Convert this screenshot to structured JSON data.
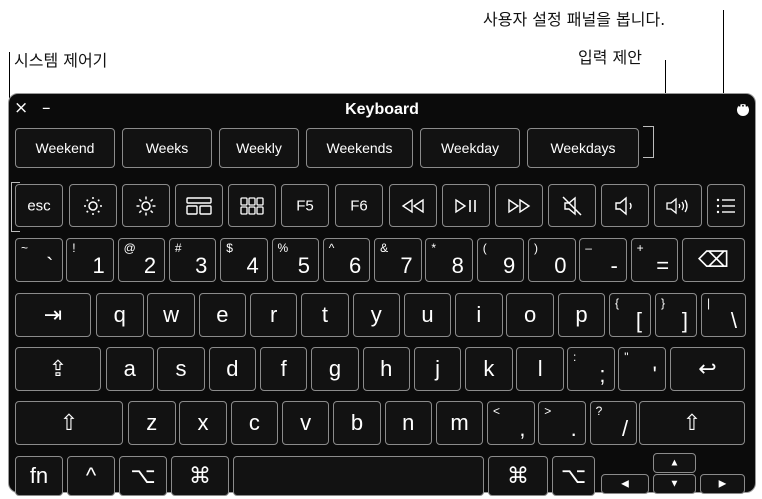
{
  "callouts": {
    "system_controls": "시스템 제어기",
    "input_suggestions": "입력 제안",
    "preferences": "사용자 설정 패널을 봅니다."
  },
  "window": {
    "title": "Keyboard",
    "close_icon": "×",
    "minimize_icon": "–"
  },
  "suggestions": [
    "Weekend",
    "Weeks",
    "Weekly",
    "Weekends",
    "Weekday",
    "Weekdays"
  ],
  "system_keys": {
    "esc": "esc",
    "f5": "F5",
    "f6": "F6",
    "icons": [
      "brightness-down-icon",
      "brightness-up-icon",
      "mission-control-icon",
      "launchpad-icon",
      "rewind-icon",
      "play-pause-icon",
      "fast-forward-icon",
      "mute-icon",
      "volume-down-icon",
      "volume-up-icon",
      "panel-options-icon"
    ]
  },
  "number_row": [
    {
      "shift": "~",
      "main": "`"
    },
    {
      "shift": "!",
      "main": "1"
    },
    {
      "shift": "@",
      "main": "2"
    },
    {
      "shift": "#",
      "main": "3"
    },
    {
      "shift": "$",
      "main": "4"
    },
    {
      "shift": "%",
      "main": "5"
    },
    {
      "shift": "^",
      "main": "6"
    },
    {
      "shift": "&",
      "main": "7"
    },
    {
      "shift": "*",
      "main": "8"
    },
    {
      "shift": "(",
      "main": "9"
    },
    {
      "shift": ")",
      "main": "0"
    },
    {
      "shift": "–",
      "main": "-"
    },
    {
      "shift": "+",
      "main": "="
    }
  ],
  "delete_glyph": "⌫",
  "tab_glyph": "⇥",
  "row_q": [
    "q",
    "w",
    "e",
    "r",
    "t",
    "y",
    "u",
    "i",
    "o",
    "p"
  ],
  "row_q_extra": [
    {
      "shift": "{",
      "main": "["
    },
    {
      "shift": "}",
      "main": "]"
    },
    {
      "shift": "|",
      "main": "\\"
    }
  ],
  "row_a": [
    "a",
    "s",
    "d",
    "f",
    "g",
    "h",
    "j",
    "k",
    "l"
  ],
  "row_a_extra": [
    {
      "shift": ":",
      "main": ";"
    },
    {
      "shift": "\"",
      "main": "'"
    }
  ],
  "capslock_glyph": "⇪",
  "return_glyph": "↩",
  "row_z": [
    "z",
    "x",
    "c",
    "v",
    "b",
    "n",
    "m"
  ],
  "row_z_extra": [
    {
      "shift": "<",
      "main": ","
    },
    {
      "shift": ">",
      "main": "."
    },
    {
      "shift": "?",
      "main": "/"
    }
  ],
  "shift_glyph": "⇧",
  "bottom": {
    "fn": "fn",
    "ctrl": "^",
    "option": "⌥",
    "command": "⌘"
  },
  "arrows": {
    "up": "▲",
    "down": "▼",
    "left": "◀",
    "right": "▶"
  }
}
